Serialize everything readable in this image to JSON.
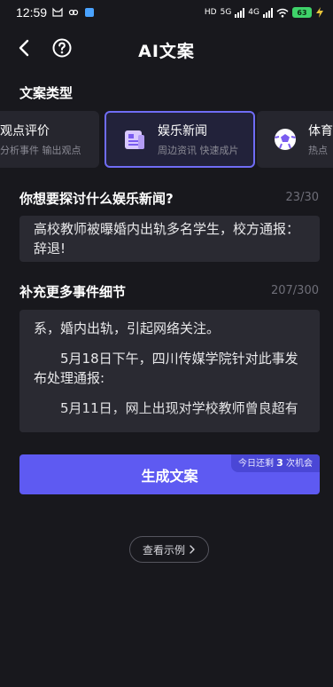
{
  "status_bar": {
    "time": "12:59",
    "network_labels": [
      "HD",
      "5G",
      "4G"
    ],
    "battery": "63"
  },
  "nav": {
    "title": "AI文案"
  },
  "type_section": {
    "label": "文案类型",
    "cards": [
      {
        "title": "观点评价",
        "subtitle": "分析事件 输出观点",
        "icon": "compass-icon",
        "active": false
      },
      {
        "title": "娱乐新闻",
        "subtitle": "周边资讯 快速成片",
        "icon": "news-icon",
        "active": true
      },
      {
        "title": "体育",
        "subtitle": "热点",
        "icon": "soccer-ball-icon",
        "active": false
      }
    ]
  },
  "topic": {
    "label": "你想要探讨什么娱乐新闻?",
    "counter": "23/30",
    "value": "高校教师被曝婚内出轨多名学生，校方通报：辞退!"
  },
  "detail": {
    "label": "补充更多事件细节",
    "counter": "207/300",
    "paragraphs": [
      "系，婚内出轨，引起网络关注。",
      "5月18日下午，四川传媒学院针对此事发布处理通报:",
      "5月11日，网上出现对学校教师曾良超有"
    ]
  },
  "generate": {
    "label": "生成文案",
    "quota_prefix": "今日还剩",
    "quota_count": "3",
    "quota_suffix": "次机会"
  },
  "example": {
    "label": "查看示例"
  },
  "colors": {
    "background": "#18181d",
    "accent": "#5e5af2",
    "active_border": "#6f6cf5",
    "input_bg": "#2a2a32"
  }
}
